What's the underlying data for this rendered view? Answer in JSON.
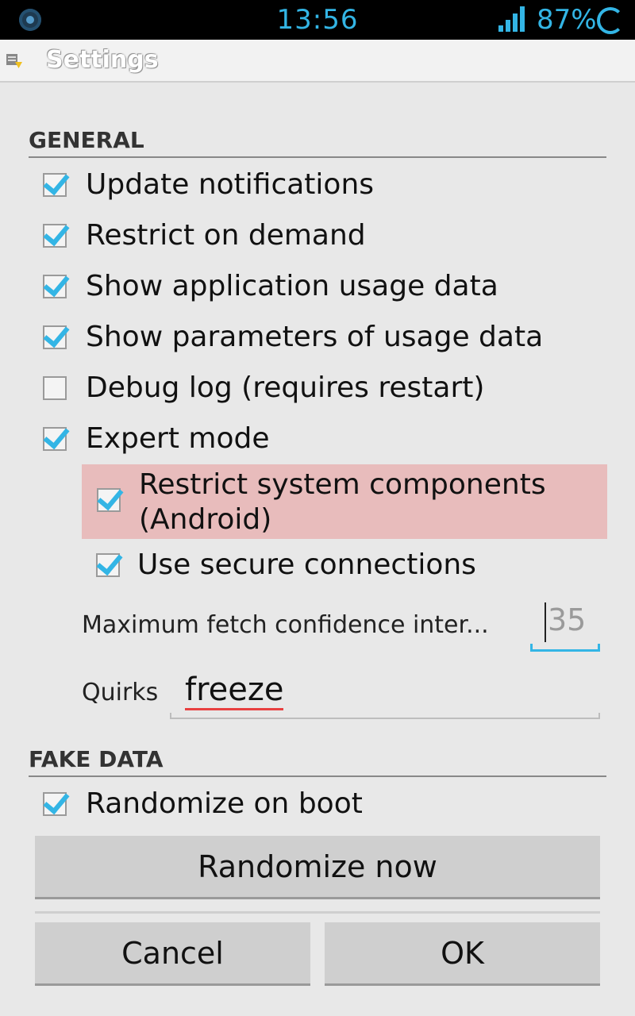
{
  "status_bar": {
    "time": "13:56",
    "battery": "87%"
  },
  "title_bar": {
    "title": "Settings"
  },
  "general": {
    "header": "GENERAL",
    "options": [
      {
        "label": "Update notifications",
        "checked": true
      },
      {
        "label": "Restrict on demand",
        "checked": true
      },
      {
        "label": "Show application usage data",
        "checked": true
      },
      {
        "label": "Show parameters of usage data",
        "checked": true
      },
      {
        "label": "Debug log (requires restart)",
        "checked": false
      },
      {
        "label": "Expert mode",
        "checked": true
      }
    ],
    "expert": {
      "restrict_system_line1": "Restrict system components",
      "restrict_system_line2": "(Android)",
      "restrict_system_checked": true,
      "secure_connections": "Use secure connections",
      "secure_connections_checked": true,
      "fetch_label": "Maximum fetch confidence inter...",
      "fetch_value": "35",
      "quirks_label": "Quirks",
      "quirks_value": "freeze"
    }
  },
  "fake_data": {
    "header": "FAKE DATA",
    "randomize_on_boot": "Randomize on boot",
    "randomize_on_boot_checked": true,
    "randomize_now_label": "Randomize now"
  },
  "buttons": {
    "cancel_label": "Cancel",
    "ok_label": "OK"
  },
  "colors": {
    "accent": "#33b5e5",
    "highlight": "#e8bcbc",
    "spellcheck": "#e84040"
  }
}
